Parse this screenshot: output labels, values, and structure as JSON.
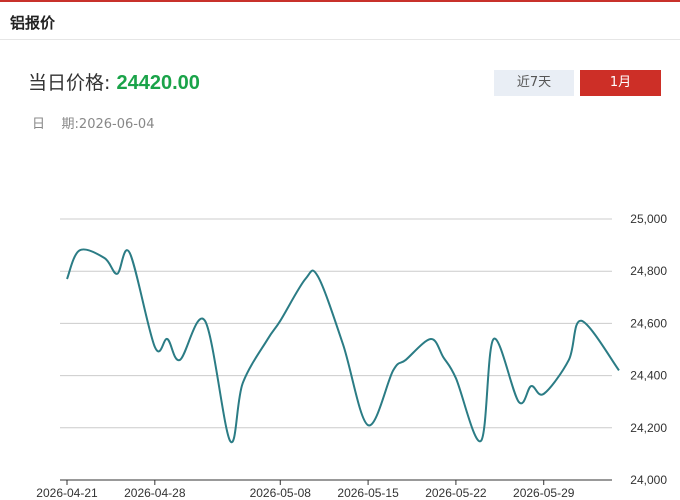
{
  "header": {
    "title": "铝报价"
  },
  "price": {
    "label": "当日价格:",
    "value": "24420.00"
  },
  "date": {
    "label": "日    期:",
    "value": "2026-06-04"
  },
  "tabs": [
    {
      "label": "近7天",
      "active": false
    },
    {
      "label": "1月",
      "active": true
    }
  ],
  "colors": {
    "accent": "#cd2f27",
    "price": "#1aa349",
    "line": "#2b7c85"
  },
  "chart_data": {
    "type": "line",
    "x": [
      "2026-04-21",
      "2026-04-22",
      "2026-04-23",
      "2026-04-24",
      "2026-04-25",
      "2026-04-26",
      "2026-04-27",
      "2026-04-28",
      "2026-04-29",
      "2026-04-30",
      "2026-05-01",
      "2026-05-02",
      "2026-05-03",
      "2026-05-04",
      "2026-05-05",
      "2026-05-06",
      "2026-05-07",
      "2026-05-08",
      "2026-05-09",
      "2026-05-10",
      "2026-05-11",
      "2026-05-12",
      "2026-05-13",
      "2026-05-14",
      "2026-05-15",
      "2026-05-16",
      "2026-05-17",
      "2026-05-18",
      "2026-05-19",
      "2026-05-20",
      "2026-05-21",
      "2026-05-22",
      "2026-05-23",
      "2026-05-24",
      "2026-05-25",
      "2026-05-26",
      "2026-05-27",
      "2026-05-28",
      "2026-05-29",
      "2026-05-30",
      "2026-05-31",
      "2026-06-01",
      "2026-06-02",
      "2026-06-03",
      "2026-06-04"
    ],
    "values": [
      24770,
      24880,
      24850,
      24790,
      24870,
      24510,
      24540,
      24460,
      24610,
      24150,
      24370,
      24540,
      24610,
      24770,
      24780,
      24520,
      24210,
      24420,
      24460,
      24540,
      24470,
      24390,
      24150,
      24540,
      24300,
      24360,
      24330,
      24460,
      24610,
      24420
    ],
    "value_dates": [
      "2026-04-21",
      "2026-04-22",
      "2026-04-24",
      "2026-04-25",
      "2026-04-26",
      "2026-04-28",
      "2026-04-29",
      "2026-04-30",
      "2026-05-02",
      "2026-05-04",
      "2026-05-05",
      "2026-05-07",
      "2026-05-08",
      "2026-05-10",
      "2026-05-11",
      "2026-05-13",
      "2026-05-15",
      "2026-05-17",
      "2026-05-18",
      "2026-05-20",
      "2026-05-21",
      "2026-05-22",
      "2026-05-24",
      "2026-05-25",
      "2026-05-27",
      "2026-05-28",
      "2026-05-29",
      "2026-05-31",
      "2026-06-01",
      "2026-06-04"
    ],
    "x_ticks": [
      "2026-04-21",
      "2026-04-28",
      "2026-05-08",
      "2026-05-15",
      "2026-05-22",
      "2026-05-29"
    ],
    "y_ticks": [
      24000,
      24200,
      24400,
      24600,
      24800,
      25000
    ],
    "y_tick_labels": [
      "24,000",
      "24,200",
      "24,400",
      "24,600",
      "24,800",
      "25,000"
    ],
    "ylim": [
      24000,
      25000
    ],
    "grid": true,
    "xlabel": "",
    "ylabel": ""
  }
}
